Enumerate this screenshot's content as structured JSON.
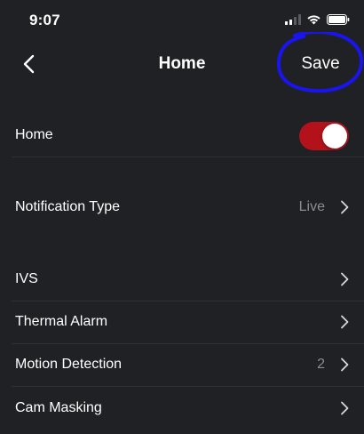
{
  "status_bar": {
    "time": "9:07",
    "icons": [
      "cellular-signal-icon",
      "wifi-icon",
      "battery-icon"
    ]
  },
  "nav": {
    "back_icon": "chevron-left-icon",
    "title": "Home",
    "save_label": "Save",
    "save_highlight_color": "#1a14f0"
  },
  "settings": {
    "home_toggle": {
      "label": "Home",
      "enabled": true,
      "on_color": "#b3121b"
    },
    "notification_type": {
      "label": "Notification Type",
      "value": "Live"
    },
    "ivs": {
      "label": "IVS"
    },
    "thermal_alarm": {
      "label": "Thermal Alarm"
    },
    "motion_detection": {
      "label": "Motion Detection",
      "value": "2"
    },
    "cam_masking": {
      "label": "Cam Masking"
    }
  },
  "colors": {
    "background": "#202125",
    "text": "#ffffff",
    "secondary_text": "#8b8c90",
    "divider": "#2f3035"
  }
}
